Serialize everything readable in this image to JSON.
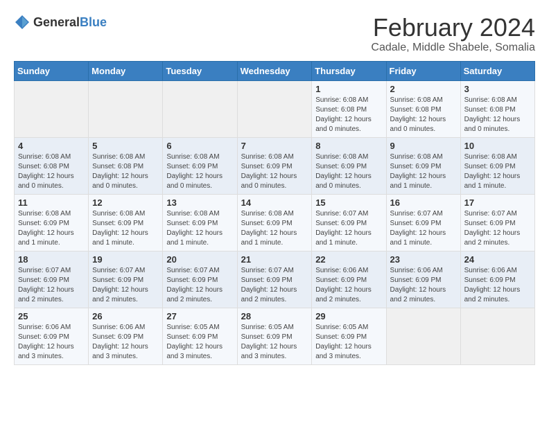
{
  "logo": {
    "text_general": "General",
    "text_blue": "Blue"
  },
  "header": {
    "title": "February 2024",
    "subtitle": "Cadale, Middle Shabele, Somalia"
  },
  "calendar": {
    "days_of_week": [
      "Sunday",
      "Monday",
      "Tuesday",
      "Wednesday",
      "Thursday",
      "Friday",
      "Saturday"
    ],
    "weeks": [
      [
        {
          "day": "",
          "info": ""
        },
        {
          "day": "",
          "info": ""
        },
        {
          "day": "",
          "info": ""
        },
        {
          "day": "",
          "info": ""
        },
        {
          "day": "1",
          "info": "Sunrise: 6:08 AM\nSunset: 6:08 PM\nDaylight: 12 hours\nand 0 minutes."
        },
        {
          "day": "2",
          "info": "Sunrise: 6:08 AM\nSunset: 6:08 PM\nDaylight: 12 hours\nand 0 minutes."
        },
        {
          "day": "3",
          "info": "Sunrise: 6:08 AM\nSunset: 6:08 PM\nDaylight: 12 hours\nand 0 minutes."
        }
      ],
      [
        {
          "day": "4",
          "info": "Sunrise: 6:08 AM\nSunset: 6:08 PM\nDaylight: 12 hours\nand 0 minutes."
        },
        {
          "day": "5",
          "info": "Sunrise: 6:08 AM\nSunset: 6:08 PM\nDaylight: 12 hours\nand 0 minutes."
        },
        {
          "day": "6",
          "info": "Sunrise: 6:08 AM\nSunset: 6:09 PM\nDaylight: 12 hours\nand 0 minutes."
        },
        {
          "day": "7",
          "info": "Sunrise: 6:08 AM\nSunset: 6:09 PM\nDaylight: 12 hours\nand 0 minutes."
        },
        {
          "day": "8",
          "info": "Sunrise: 6:08 AM\nSunset: 6:09 PM\nDaylight: 12 hours\nand 0 minutes."
        },
        {
          "day": "9",
          "info": "Sunrise: 6:08 AM\nSunset: 6:09 PM\nDaylight: 12 hours\nand 1 minute."
        },
        {
          "day": "10",
          "info": "Sunrise: 6:08 AM\nSunset: 6:09 PM\nDaylight: 12 hours\nand 1 minute."
        }
      ],
      [
        {
          "day": "11",
          "info": "Sunrise: 6:08 AM\nSunset: 6:09 PM\nDaylight: 12 hours\nand 1 minute."
        },
        {
          "day": "12",
          "info": "Sunrise: 6:08 AM\nSunset: 6:09 PM\nDaylight: 12 hours\nand 1 minute."
        },
        {
          "day": "13",
          "info": "Sunrise: 6:08 AM\nSunset: 6:09 PM\nDaylight: 12 hours\nand 1 minute."
        },
        {
          "day": "14",
          "info": "Sunrise: 6:08 AM\nSunset: 6:09 PM\nDaylight: 12 hours\nand 1 minute."
        },
        {
          "day": "15",
          "info": "Sunrise: 6:07 AM\nSunset: 6:09 PM\nDaylight: 12 hours\nand 1 minute."
        },
        {
          "day": "16",
          "info": "Sunrise: 6:07 AM\nSunset: 6:09 PM\nDaylight: 12 hours\nand 1 minute."
        },
        {
          "day": "17",
          "info": "Sunrise: 6:07 AM\nSunset: 6:09 PM\nDaylight: 12 hours\nand 2 minutes."
        }
      ],
      [
        {
          "day": "18",
          "info": "Sunrise: 6:07 AM\nSunset: 6:09 PM\nDaylight: 12 hours\nand 2 minutes."
        },
        {
          "day": "19",
          "info": "Sunrise: 6:07 AM\nSunset: 6:09 PM\nDaylight: 12 hours\nand 2 minutes."
        },
        {
          "day": "20",
          "info": "Sunrise: 6:07 AM\nSunset: 6:09 PM\nDaylight: 12 hours\nand 2 minutes."
        },
        {
          "day": "21",
          "info": "Sunrise: 6:07 AM\nSunset: 6:09 PM\nDaylight: 12 hours\nand 2 minutes."
        },
        {
          "day": "22",
          "info": "Sunrise: 6:06 AM\nSunset: 6:09 PM\nDaylight: 12 hours\nand 2 minutes."
        },
        {
          "day": "23",
          "info": "Sunrise: 6:06 AM\nSunset: 6:09 PM\nDaylight: 12 hours\nand 2 minutes."
        },
        {
          "day": "24",
          "info": "Sunrise: 6:06 AM\nSunset: 6:09 PM\nDaylight: 12 hours\nand 2 minutes."
        }
      ],
      [
        {
          "day": "25",
          "info": "Sunrise: 6:06 AM\nSunset: 6:09 PM\nDaylight: 12 hours\nand 3 minutes."
        },
        {
          "day": "26",
          "info": "Sunrise: 6:06 AM\nSunset: 6:09 PM\nDaylight: 12 hours\nand 3 minutes."
        },
        {
          "day": "27",
          "info": "Sunrise: 6:05 AM\nSunset: 6:09 PM\nDaylight: 12 hours\nand 3 minutes."
        },
        {
          "day": "28",
          "info": "Sunrise: 6:05 AM\nSunset: 6:09 PM\nDaylight: 12 hours\nand 3 minutes."
        },
        {
          "day": "29",
          "info": "Sunrise: 6:05 AM\nSunset: 6:09 PM\nDaylight: 12 hours\nand 3 minutes."
        },
        {
          "day": "",
          "info": ""
        },
        {
          "day": "",
          "info": ""
        }
      ]
    ]
  }
}
